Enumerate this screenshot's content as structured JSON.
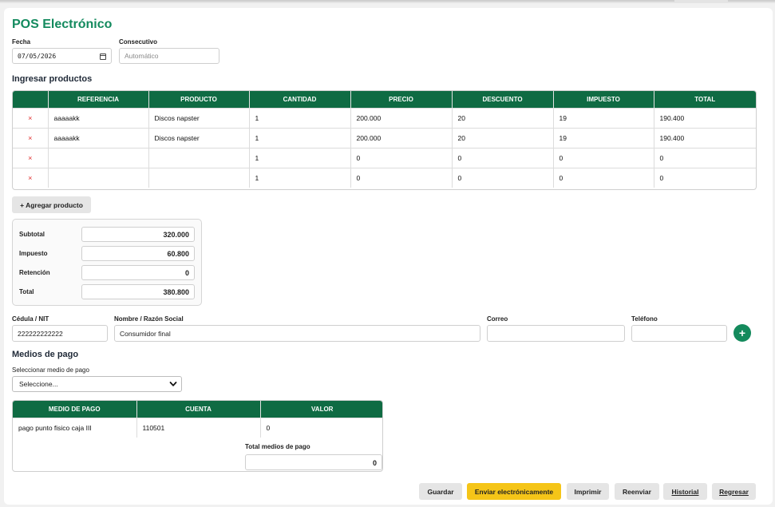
{
  "app": {
    "title": "POS Electrónico"
  },
  "header": {
    "fecha_label": "Fecha",
    "fecha_value": "07/05/2026",
    "consecutivo_label": "Consecutivo",
    "consecutivo_placeholder": "Automático"
  },
  "products": {
    "section_title": "Ingresar productos",
    "columns": [
      "REFERENCIA",
      "PRODUCTO",
      "CANTIDAD",
      "PRECIO",
      "DESCUENTO",
      "IMPUESTO",
      "TOTAL"
    ],
    "rows": [
      {
        "remove": "×",
        "referencia": "aaaaakk",
        "producto": "Discos napster",
        "cantidad": "1",
        "precio": "200.000",
        "descuento": "20",
        "impuesto": "19",
        "total": "190.400"
      },
      {
        "remove": "×",
        "referencia": "aaaaakk",
        "producto": "Discos napster",
        "cantidad": "1",
        "precio": "200.000",
        "descuento": "20",
        "impuesto": "19",
        "total": "190.400"
      },
      {
        "remove": "×",
        "referencia": "",
        "producto": "",
        "cantidad": "1",
        "precio": "0",
        "descuento": "0",
        "impuesto": "0",
        "total": "0"
      },
      {
        "remove": "×",
        "referencia": "",
        "producto": "",
        "cantidad": "1",
        "precio": "0",
        "descuento": "0",
        "impuesto": "0",
        "total": "0"
      }
    ],
    "add_button": "+ Agregar producto"
  },
  "totals": {
    "subtotal_label": "Subtotal",
    "subtotal_value": "320.000",
    "impuesto_label": "Impuesto",
    "impuesto_value": "60.800",
    "retencion_label": "Retención",
    "retencion_value": "0",
    "total_label": "Total",
    "total_value": "380.800"
  },
  "client": {
    "nit_label": "Cédula / NIT",
    "nit_value": "222222222222",
    "nombre_label": "Nombre / Razón Social",
    "nombre_value": "Consumidor final",
    "correo_label": "Correo",
    "correo_value": "",
    "telefono_label": "Teléfono",
    "telefono_value": "",
    "add_icon": "+"
  },
  "payments": {
    "section_title": "Medios de pago",
    "select_label": "Seleccionar medio de pago",
    "select_value": "Seleccione...",
    "columns": [
      "MEDIO DE PAGO",
      "CUENTA",
      "VALOR"
    ],
    "rows": [
      {
        "medio": "pago punto fisico caja III",
        "cuenta": "110501",
        "valor": "0"
      }
    ],
    "total_label": "Total medios de pago",
    "total_value": "0"
  },
  "actions": {
    "guardar": "Guardar",
    "enviar": "Enviar electrónicamente",
    "imprimir": "Imprimir",
    "reenviar": "Reenviar",
    "historial": "Historial",
    "regresar": "Regresar"
  },
  "colors": {
    "brand_green": "#0f6b43",
    "title_green": "#138a5e",
    "accent_yellow": "#f5c518",
    "remove_red": "#e03131"
  }
}
